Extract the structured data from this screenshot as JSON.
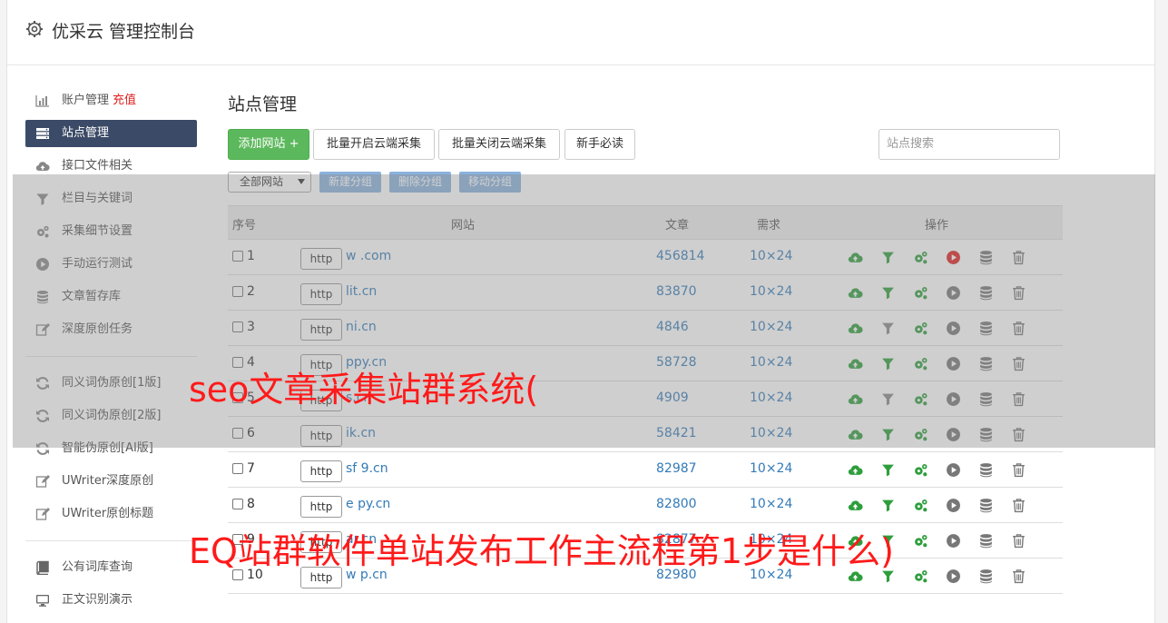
{
  "header": {
    "title": "优采云 管理控制台"
  },
  "sidebar": {
    "items": [
      {
        "label": "账户管理",
        "extra": "充值",
        "icon": "bar-chart-icon"
      },
      {
        "label": "站点管理",
        "icon": "server-list-icon",
        "active": true
      },
      {
        "label": "接口文件相关",
        "icon": "cloud-upload-icon"
      },
      {
        "label": "栏目与关键词",
        "icon": "filter-icon"
      },
      {
        "label": "采集细节设置",
        "icon": "cogs-icon"
      },
      {
        "label": "手动运行测试",
        "icon": "play-circle-icon"
      },
      {
        "label": "文章暂存库",
        "icon": "database-icon"
      },
      {
        "label": "深度原创任务",
        "icon": "edit-icon"
      }
    ],
    "items2": [
      {
        "label": "同义词伪原创[1版]",
        "icon": "refresh-icon"
      },
      {
        "label": "同义词伪原创[2版]",
        "icon": "refresh-icon"
      },
      {
        "label": "智能伪原创[AI版]",
        "icon": "refresh-icon"
      },
      {
        "label": "UWriter深度原创",
        "icon": "edit-icon"
      },
      {
        "label": "UWriter原创标题",
        "icon": "edit-icon"
      }
    ],
    "items3": [
      {
        "label": "公有词库查询",
        "icon": "book-icon"
      },
      {
        "label": "正文识别演示",
        "icon": "monitor-icon"
      }
    ]
  },
  "main": {
    "title": "站点管理",
    "toolbar": {
      "add_site": "添加网站 +",
      "batch_open": "批量开启云端采集",
      "batch_close": "批量关闭云端采集",
      "newbie": "新手必读",
      "search_placeholder": "站点搜索"
    },
    "group": {
      "select_value": "全部网站",
      "new_group": "新建分组",
      "delete_group": "删除分组",
      "move_group": "移动分组"
    },
    "table": {
      "headers": {
        "index": "序号",
        "site": "网站",
        "articles": "文章",
        "demand": "需求",
        "ops": "操作"
      },
      "rows": [
        {
          "num": "1",
          "proto": "http",
          "site": "w          .com",
          "articles": "456814",
          "demand": "10×24",
          "active": true
        },
        {
          "num": "2",
          "proto": "http",
          "site": "      lit.cn",
          "articles": "83870",
          "demand": "10×24",
          "active": false
        },
        {
          "num": "3",
          "proto": "http",
          "site": "      ni.cn",
          "articles": "4846",
          "demand": "10×24",
          "active": false
        },
        {
          "num": "4",
          "proto": "http",
          "site": "      ppy.cn",
          "articles": "58728",
          "demand": "10×24",
          "active": false
        },
        {
          "num": "5",
          "proto": "http",
          "site": "      s.cn",
          "articles": "4909",
          "demand": "10×24",
          "active": false
        },
        {
          "num": "6",
          "proto": "http",
          "site": "      ik.cn",
          "articles": "58421",
          "demand": "10×24",
          "active": false
        },
        {
          "num": "7",
          "proto": "http",
          "site": "sf  9.cn",
          "articles": "82987",
          "demand": "10×24",
          "active": false
        },
        {
          "num": "8",
          "proto": "http",
          "site": "e    py.cn",
          "articles": "82800",
          "demand": "10×24",
          "active": false
        },
        {
          "num": "9",
          "proto": "http",
          "site": "      ar.cn",
          "articles": "82877",
          "demand": "10×24",
          "active": false
        },
        {
          "num": "10",
          "proto": "http",
          "site": "w    p.cn",
          "articles": "82980",
          "demand": "10×24",
          "active": false
        }
      ]
    }
  },
  "captions": {
    "line1": "seo文章采集站群系统(",
    "line2": "EQ站群软件单站发布工作主流程第1步是什么)"
  },
  "colors": {
    "accent_green": "#5cb85c",
    "sidebar_active": "#3b4a66",
    "link_blue": "#337ab7",
    "caption_red": "#ff1a1a"
  }
}
